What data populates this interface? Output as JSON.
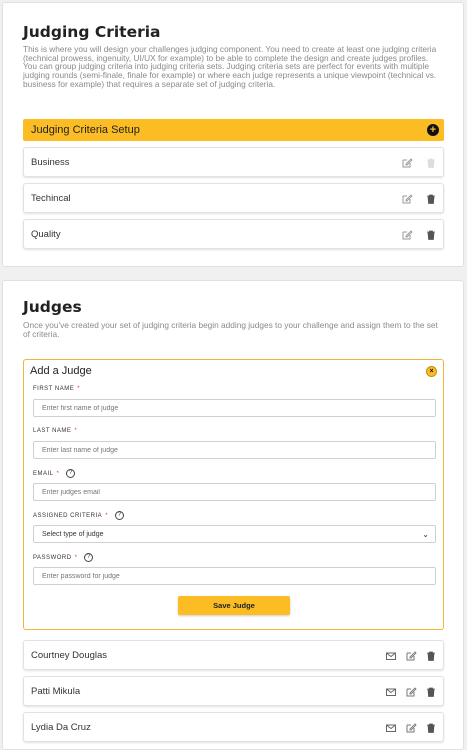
{
  "criteria_section": {
    "title": "Judging Criteria",
    "description": "This is where you will design your challenges judging component. You need to create at least one judging criteria (technical prowess, ingenuity, UI/UX for example) to be able to complete the design and create judges profiles. You can group judging criteria into judging criteria sets. Judging criteria sets are perfect for events with multiple judging rounds (semi-finale, finale for example) or where each judge represents a unique viewpoint (technical vs. business for example) that requires a separate set of judging criteria.",
    "setup_label": "Judging Criteria Setup",
    "items": [
      {
        "label": "Business"
      },
      {
        "label": "Techincal"
      },
      {
        "label": "Quality"
      }
    ]
  },
  "judges_section": {
    "title": "Judges",
    "description": "Once you've created your set of judging criteria begin adding judges to your challenge and assign them to the set of criteria.",
    "add_form": {
      "title": "Add a Judge",
      "close_icon": "×",
      "first_name": {
        "label": "FIRST NAME",
        "placeholder": "Enter first name of judge"
      },
      "last_name": {
        "label": "LAST NAME",
        "placeholder": "Enter last name of judge"
      },
      "email": {
        "label": "EMAIL",
        "placeholder": "Enter judges email"
      },
      "assigned_criteria": {
        "label": "ASSIGNED CRITERIA",
        "selected": "Select type of judge"
      },
      "password": {
        "label": "PASSWORD",
        "placeholder": "Enter password for judge"
      },
      "save_label": "Save Judge",
      "required_mark": "*",
      "help_mark": "?"
    },
    "judges": [
      {
        "name": "Courtney Douglas"
      },
      {
        "name": "Patti Mikula"
      },
      {
        "name": "Lydia Da Cruz"
      }
    ]
  },
  "colors": {
    "accent": "#fbbd23",
    "required": "#e04040"
  },
  "icons": {
    "add": "plus-circle-icon",
    "edit": "edit-icon",
    "delete": "trash-icon",
    "mail": "mail-icon",
    "help": "question-circle-icon",
    "close": "close-circle-icon",
    "dropdown": "chevron-down-icon"
  }
}
